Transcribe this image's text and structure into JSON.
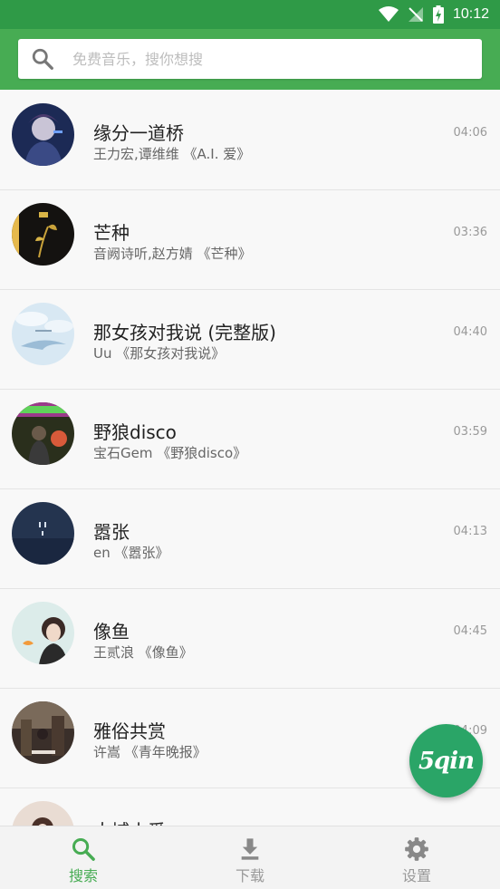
{
  "status_bar": {
    "time": "10:12"
  },
  "search": {
    "placeholder": "免费音乐，搜你想搜"
  },
  "songs": [
    {
      "title": "缘分一道桥",
      "subtitle": "王力宏,谭维维 《A.I. 爱》",
      "duration": "04:06"
    },
    {
      "title": "芒种",
      "subtitle": "音阙诗听,赵方婧 《芒种》",
      "duration": "03:36"
    },
    {
      "title": "那女孩对我说 (完整版)",
      "subtitle": "Uu 《那女孩对我说》",
      "duration": "04:40"
    },
    {
      "title": "野狼disco",
      "subtitle": "宝石Gem 《野狼disco》",
      "duration": "03:59"
    },
    {
      "title": "嚣张",
      "subtitle": "en 《嚣张》",
      "duration": "04:13"
    },
    {
      "title": "像鱼",
      "subtitle": "王贰浪 《像鱼》",
      "duration": "04:45"
    },
    {
      "title": "雅俗共赏",
      "subtitle": "许嵩 《青年晚报》",
      "duration": "04:09"
    },
    {
      "title": "大城小爱",
      "subtitle": "",
      "duration": ""
    }
  ],
  "fab": {
    "label": "5qin"
  },
  "bottom_nav": [
    {
      "label": "搜索",
      "icon": "search-icon",
      "active": true
    },
    {
      "label": "下载",
      "icon": "download-icon",
      "active": false
    },
    {
      "label": "设置",
      "icon": "gear-icon",
      "active": false
    }
  ],
  "colors": {
    "status_bar": "#2f9a47",
    "header": "#47ac53",
    "accent": "#47ac53",
    "fab": "#2aa567"
  }
}
